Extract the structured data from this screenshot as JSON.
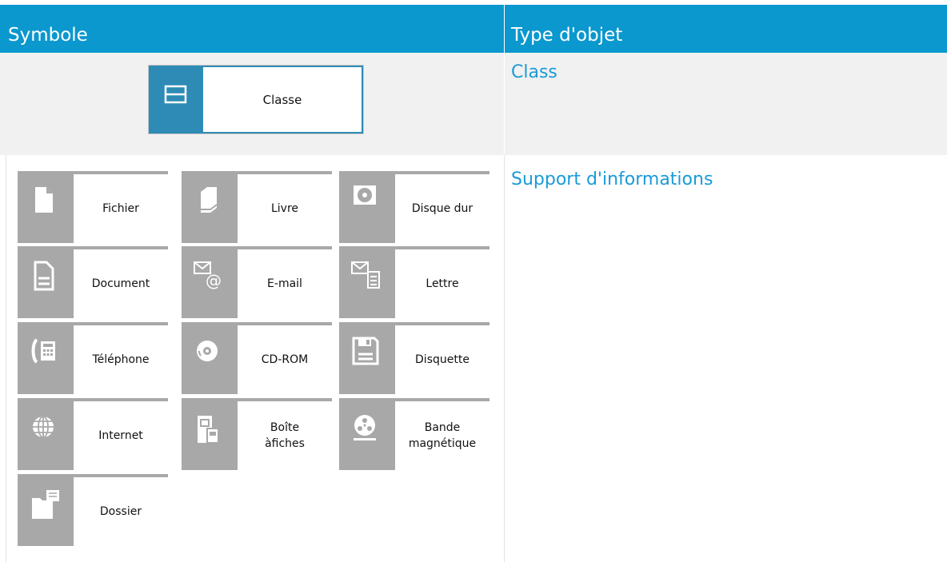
{
  "header": {
    "symbol_label": "Symbole",
    "type_label": "Type d'objet"
  },
  "rows": [
    {
      "type": "Class",
      "symbols": [
        {
          "label": "Classe",
          "icon": "class-icon"
        }
      ]
    },
    {
      "type": "Support d'informations",
      "symbols": [
        {
          "label": "Fichier",
          "icon": "file-icon"
        },
        {
          "label": "Livre",
          "icon": "book-icon"
        },
        {
          "label": "Disque dur",
          "icon": "hard-disk-icon"
        },
        {
          "label": "Document",
          "icon": "document-icon"
        },
        {
          "label": "E-mail",
          "icon": "email-icon"
        },
        {
          "label": "Lettre",
          "icon": "letter-icon"
        },
        {
          "label": "Téléphone",
          "icon": "telephone-icon"
        },
        {
          "label": "CD-ROM",
          "icon": "cd-rom-icon"
        },
        {
          "label": "Disquette",
          "icon": "floppy-disk-icon"
        },
        {
          "label": "Internet",
          "icon": "globe-icon"
        },
        {
          "label": "Boîte\nàfiches",
          "icon": "card-box-icon"
        },
        {
          "label": "Bande\nmagnétique",
          "icon": "magnetic-tape-icon"
        },
        {
          "label": "Dossier",
          "icon": "folder-icon"
        }
      ]
    }
  ],
  "colors": {
    "header_bg": "#0a98ce",
    "link": "#1a9ad8",
    "symbol_bar": "#a8a8a8",
    "class_bar": "#2e8bb5"
  }
}
